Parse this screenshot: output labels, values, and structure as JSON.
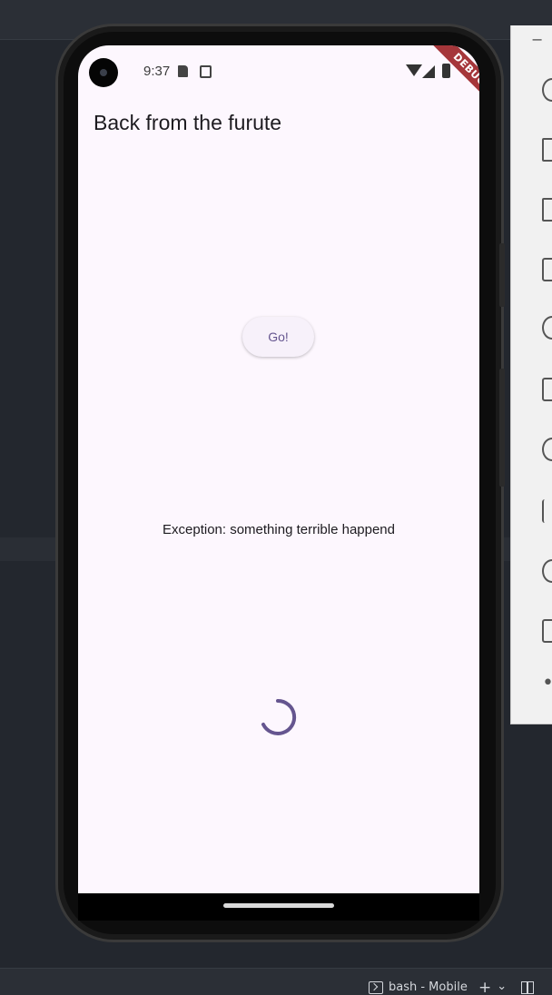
{
  "status_bar": {
    "time": "9:37",
    "debug_banner": "DEBUG"
  },
  "app": {
    "title": "Back from the furute",
    "go_button_label": "Go!",
    "error_message": "Exception: something terrible happend"
  },
  "ide": {
    "terminal_tab_label": "bash - Mobile",
    "add_terminal_glyph": "+",
    "chevron_glyph": "⌄",
    "minimize_glyph": "−"
  },
  "emulator_toolbar": {
    "tools": [
      "power-icon",
      "volume-up-icon",
      "volume-down-icon",
      "camera-icon",
      "zoom-icon",
      "rotate-left-icon",
      "rotate-right-icon",
      "back-icon",
      "home-icon",
      "overview-icon",
      "more-icon"
    ],
    "more_glyph": "••"
  },
  "colors": {
    "screen_bg": "#fdf7fe",
    "button_text": "#65558f",
    "spinner": "#65558f",
    "debug_ribbon": "#a5363a"
  }
}
